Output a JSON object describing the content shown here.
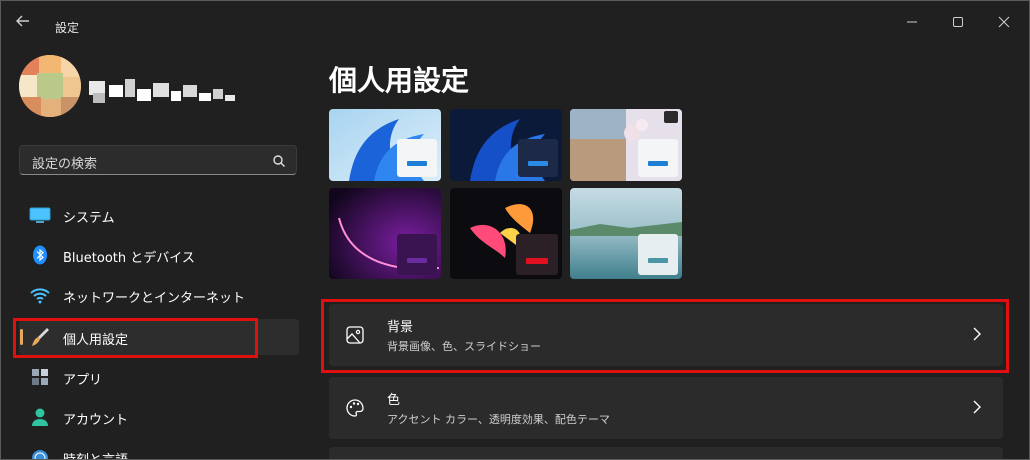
{
  "titlebar": {
    "title": "設定",
    "back_icon": "back-arrow-icon"
  },
  "user": {
    "avatar": "user-avatar-pixelated"
  },
  "search": {
    "placeholder": "設定の検索"
  },
  "nav": {
    "items": [
      {
        "label": "システム",
        "icon": "monitor-icon"
      },
      {
        "label": "Bluetooth とデバイス",
        "icon": "bluetooth-icon"
      },
      {
        "label": "ネットワークとインターネット",
        "icon": "wifi-icon"
      },
      {
        "label": "個人用設定",
        "icon": "paintbrush-icon",
        "selected": true
      },
      {
        "label": "アプリ",
        "icon": "apps-icon"
      },
      {
        "label": "アカウント",
        "icon": "person-icon"
      },
      {
        "label": "時刻と言語",
        "icon": "globe-clock-icon"
      }
    ]
  },
  "main": {
    "title": "個人用設定",
    "cards": [
      {
        "title": "背景",
        "subtitle": "背景画像、色、スライドショー",
        "icon": "image-icon"
      },
      {
        "title": "色",
        "subtitle": "アクセント カラー、透明度効果、配色テーマ",
        "icon": "palette-icon"
      }
    ]
  },
  "colors": {
    "highlight": "#e01010",
    "accent": "#e9a95c",
    "background": "#202020",
    "card": "#2b2b2b"
  }
}
